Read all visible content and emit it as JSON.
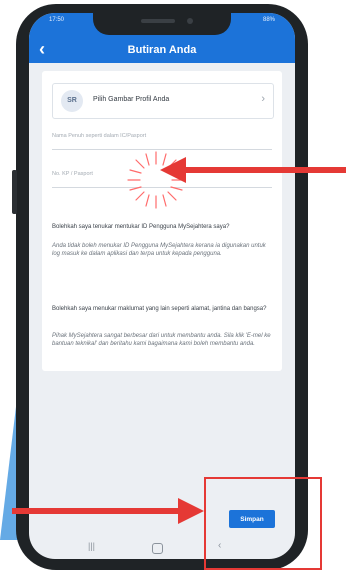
{
  "status_bar": {
    "time": "17:50",
    "battery": "88%"
  },
  "app_bar": {
    "title": "Butiran Anda",
    "back_icon": "chevron-left-icon"
  },
  "profile": {
    "avatar_initials": "SR",
    "label": "Pilih Gambar Profil Anda",
    "chevron_icon": "chevron-right-icon"
  },
  "form": {
    "name_placeholder": "Nama Penuh seperti dalam IC/Pasport",
    "id_placeholder": "No. KP / Pasport"
  },
  "faq": [
    {
      "question": "Bolehkah saya tenukar mentukar ID Pengguna MySejahtera saya?",
      "answer": "Anda tidak boleh menukar ID Pengguna MySejahtera kerana ia digunakan untuk log masuk ke dalam aplikasi dan terpa untuk kepada pengguna."
    },
    {
      "question": "Bolehkah saya menukar maklumat yang lain seperti alamat, jantina dan bangsa?",
      "answer": "Pihak MySejahtera sangat berbesar dari untuk membantu anda. Sila klik 'E-mel ke bantuan teknikal' dan beritahu kami bagaimana kami boleh membantu anda."
    }
  ],
  "actions": {
    "save_label": "Simpan"
  },
  "nav": {
    "recent_icon": "recent-apps-icon",
    "home_icon": "home-icon",
    "back_icon": "back-icon"
  },
  "colors": {
    "primary": "#1c73d9",
    "annotation_red": "#e53935",
    "accent_blue": "#4a9be0"
  }
}
